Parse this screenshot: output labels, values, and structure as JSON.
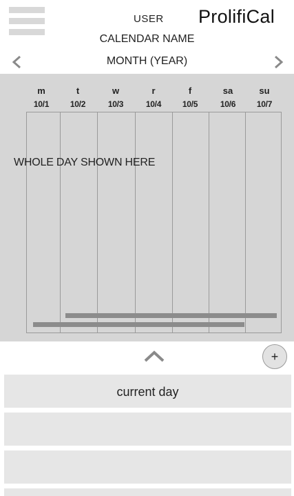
{
  "header": {
    "user_label": "USER",
    "app_name": "ProlifiCal",
    "calendar_name": "CALENDAR NAME",
    "month_label": "MONTH (YEAR)",
    "menu_icon": "hamburger-menu-icon",
    "prev_icon": "chevron-left-icon",
    "next_icon": "chevron-right-icon"
  },
  "week": {
    "days": [
      {
        "letter": "m",
        "date": "10/1"
      },
      {
        "letter": "t",
        "date": "10/2"
      },
      {
        "letter": "w",
        "date": "10/3"
      },
      {
        "letter": "r",
        "date": "10/4"
      },
      {
        "letter": "f",
        "date": "10/5"
      },
      {
        "letter": "sa",
        "date": "10/6"
      },
      {
        "letter": "su",
        "date": "10/7"
      }
    ],
    "placeholder": "WHOLE DAY SHOWN HERE"
  },
  "bottom": {
    "expand_icon": "chevron-up-icon",
    "add_label": "+",
    "cards": [
      {
        "label": "current day"
      },
      {
        "label": ""
      },
      {
        "label": ""
      },
      {
        "label": ""
      }
    ]
  },
  "colors": {
    "panel": "#d6d6d6",
    "column_border": "#9a9a9a",
    "event_bar": "#8c8c8c",
    "card": "#e6e6e6"
  }
}
